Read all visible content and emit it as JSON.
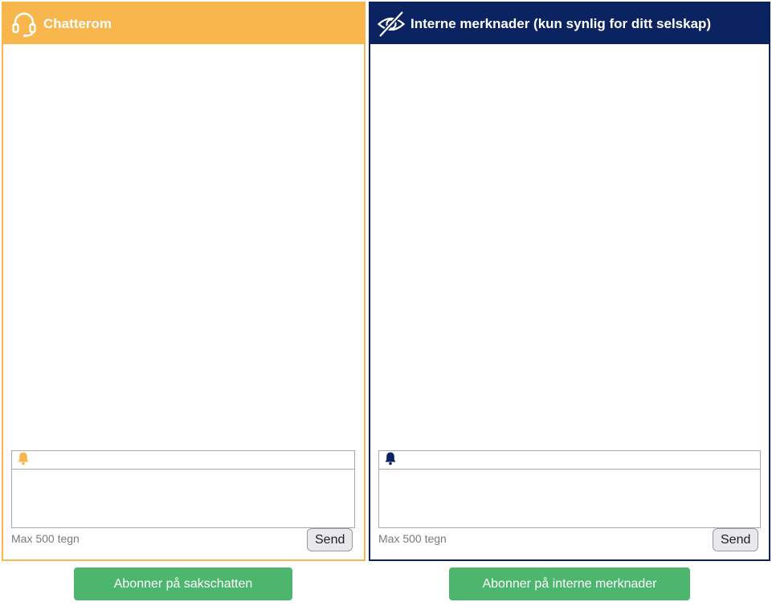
{
  "chat_panel": {
    "title": "Chatterom",
    "header_icon": "headset-icon",
    "bell_icon": "bell-icon",
    "message_placeholder": "",
    "max_label": "Max 500 tegn",
    "send_label": "Send",
    "accent_color": "#f8b64c"
  },
  "internal_panel": {
    "title": "Interne merknader (kun synlig for ditt selskap)",
    "header_icon": "eye-slash-icon",
    "bell_icon": "bell-icon",
    "message_placeholder": "",
    "max_label": "Max 500 tegn",
    "send_label": "Send",
    "accent_color": "#0b2461"
  },
  "subscribe": {
    "chat_label": "Abonner på sakschatten",
    "internal_label": "Abonner på interne merknader",
    "color": "#4cb56e"
  }
}
